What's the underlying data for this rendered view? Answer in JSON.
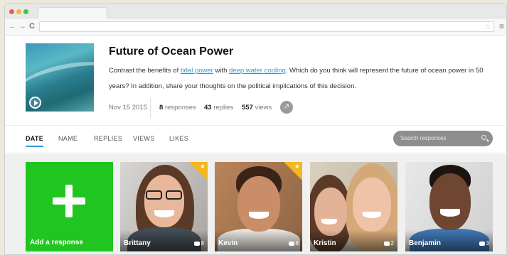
{
  "browser": {
    "back": "←",
    "forward": "→",
    "reload": "C",
    "bookmark": "☆",
    "menu": "≡"
  },
  "post": {
    "title": "Future of Ocean Power",
    "desc_1": "Contrast the benefits of ",
    "link_1": "tidal power",
    "desc_2": " with ",
    "link_2": "deep water cooling",
    "desc_3": ". Which do you think will represent the future of ocean power in 50 years? In addition, share your thoughts on the political implications of this decision.",
    "date": "Nov 15 2015",
    "responses_count": "8",
    "responses_label": "responses",
    "replies_count": "43",
    "replies_label": "replies",
    "views_count": "557",
    "views_label": "views"
  },
  "sort_tabs": [
    "DATE",
    "NAME",
    "REPLIES",
    "VIEWS",
    "LIKES"
  ],
  "search": {
    "placeholder": "Search responses"
  },
  "add_card": {
    "label": "Add a response"
  },
  "responses": [
    {
      "name": "Brittany",
      "replies": "8",
      "featured": true
    },
    {
      "name": "Kevin",
      "replies": "6",
      "featured": true
    },
    {
      "name": "Kristin",
      "replies": "2",
      "featured": false
    },
    {
      "name": "Benjamin",
      "replies": "3",
      "featured": false
    }
  ],
  "colors": {
    "accent": "#2e9bd6",
    "add_green": "#21c520",
    "featured_gold": "#f4b81c"
  }
}
